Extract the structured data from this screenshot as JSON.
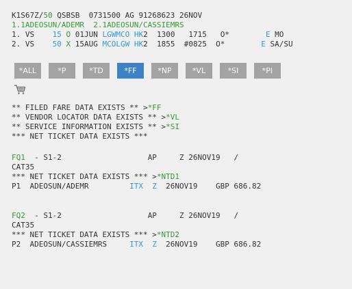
{
  "header": {
    "rec_loc": "K1S67Z/",
    "office_num": "50",
    "rest": " QSBSB  0731500 AG 91268623 26NOV"
  },
  "passengers": "1.1ADEOSUN/ADEMR  2.1ADEOSUN/CASSIEMRS",
  "segments": [
    {
      "num": "1.",
      "airline": " VS  ",
      "flight": "  15",
      "cls": " O ",
      "date": "01JUN ",
      "route": "LGWMCO",
      "status": " HK",
      "rest": "2  1300   1715   O*        ",
      "e": "E",
      "days": " MO"
    },
    {
      "num": "2.",
      "airline": " VS  ",
      "flight": "  50",
      "cls": " X ",
      "date": "15AUG ",
      "route": "MCOLGW",
      "status": " HK",
      "rest": "2  1855  #0825  O*        ",
      "e": "E",
      "days": " SA/SU"
    }
  ],
  "toolbar": {
    "buttons": [
      "*ALL",
      "*P",
      "*TD",
      "*FF",
      "*NP",
      "*VL",
      "*SI",
      "*PI"
    ],
    "active_index": 3
  },
  "notices": [
    {
      "text": "** FILED FARE DATA EXISTS ** >",
      "link": "*FF"
    },
    {
      "text": "** VENDOR LOCATOR DATA EXISTS ** >",
      "link": "*VL"
    },
    {
      "text": "** SERVICE INFORMATION EXISTS ** >",
      "link": "*SI"
    },
    {
      "text": "*** NET TICKET DATA EXISTS ***",
      "link": ""
    }
  ],
  "fares": [
    {
      "fq": "FQ1",
      "seg": "  - S1-2",
      "mid": "                   AP     Z 26NOV19   /",
      "cat": "CAT35",
      "ntd_text": "*** NET TICKET DATA EXISTS *** >",
      "ntd_link": "*NTD1",
      "pax_line": "P1  ADEOSUN/ADEMR         ",
      "itx": "ITX",
      "gap": "  ",
      "z": "Z",
      "fare_rest": "  26NOV19    GBP 686.82"
    },
    {
      "fq": "FQ2",
      "seg": "  - S1-2",
      "mid": "                   AP     Z 26NOV19   /",
      "cat": "CAT35",
      "ntd_text": "*** NET TICKET DATA EXISTS *** >",
      "ntd_link": "*NTD2",
      "pax_line": "P2  ADEOSUN/CASSIEMRS     ",
      "itx": "ITX",
      "gap": "  ",
      "z": "Z",
      "fare_rest": "  26NOV19    GBP 686.82"
    }
  ],
  "icons": {
    "cart": "shopping-cart-icon"
  }
}
